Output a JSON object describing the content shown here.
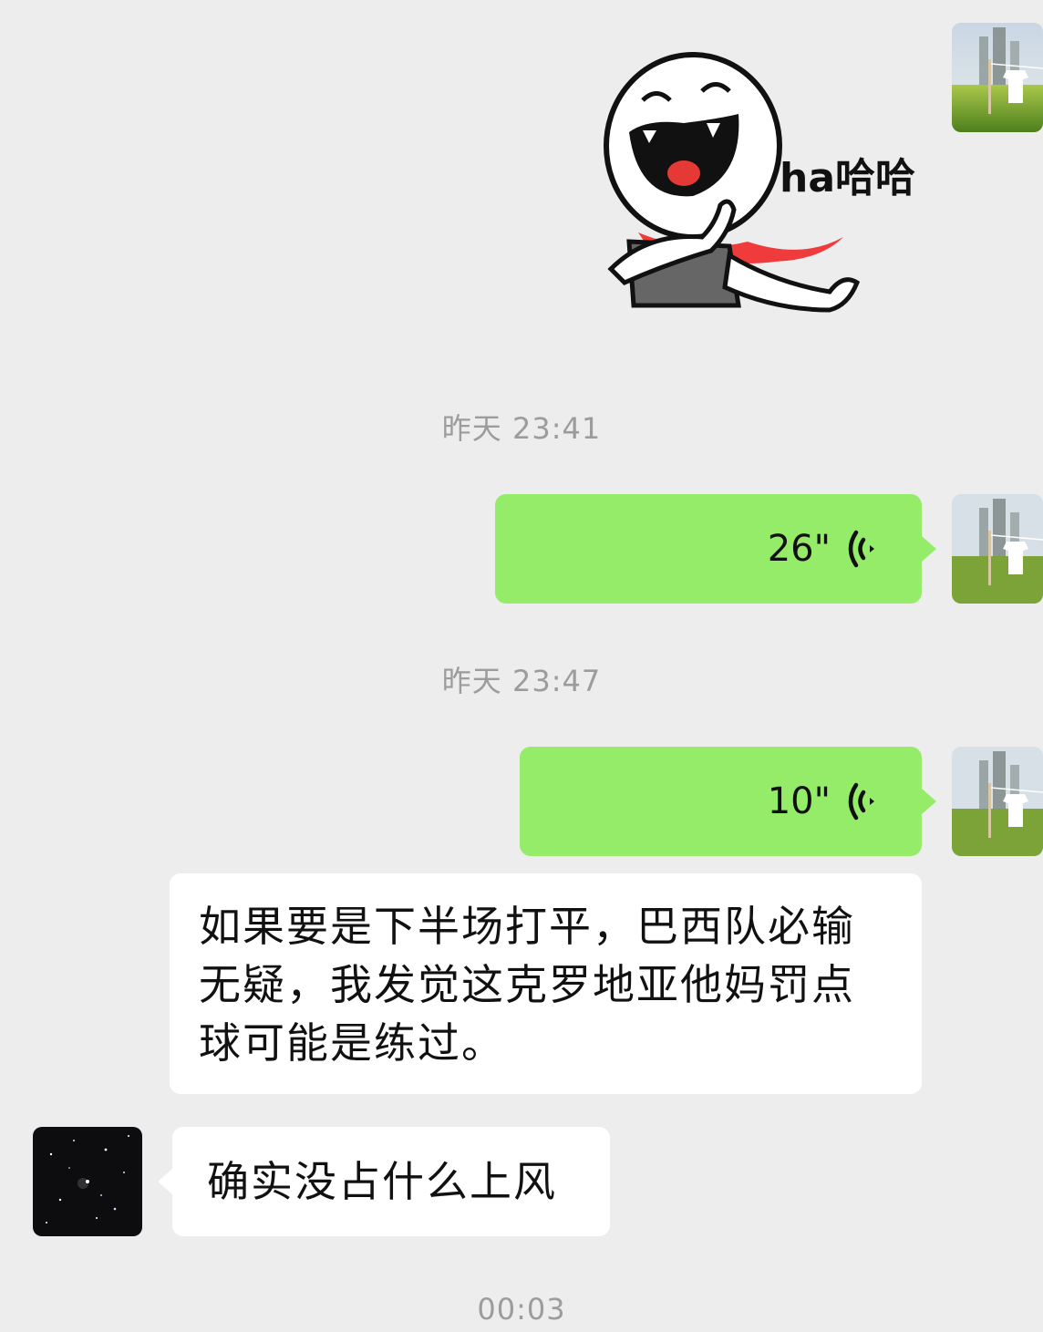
{
  "chat": {
    "messages": [
      {
        "side": "right",
        "type": "sticker",
        "sticker_text": "ha哈哈",
        "sticker_icon": "laughing-face-sticker"
      },
      {
        "type": "timestamp",
        "text": "昨天 23:41"
      },
      {
        "side": "right",
        "type": "voice",
        "duration": "26\"",
        "icon": "voice-wave-icon"
      },
      {
        "type": "timestamp",
        "text": "昨天 23:47"
      },
      {
        "side": "right",
        "type": "voice",
        "duration": "10\"",
        "icon": "voice-wave-icon"
      },
      {
        "side": "right",
        "type": "text",
        "text": "如果要是下半场打平，巴西队必输无疑，我发觉这克罗地亚他妈罚点球可能是练过。"
      },
      {
        "side": "left",
        "type": "text",
        "text": "确实没占什么上风"
      },
      {
        "type": "timestamp",
        "text": "00:03"
      }
    ]
  },
  "colors": {
    "background": "#ededed",
    "sent_bubble": "#95ec69",
    "received_bubble": "#ffffff",
    "timestamp_text": "#9c9c9c"
  }
}
